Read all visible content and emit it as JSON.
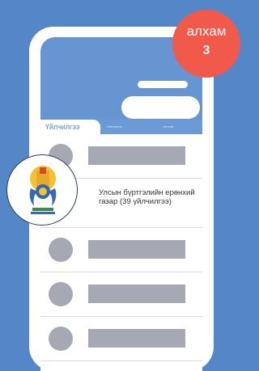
{
  "badge": {
    "label": "алхам",
    "number": "3",
    "color": "#f15a4a"
  },
  "tabs": [
    {
      "label": "Үйлчилгээ",
      "active": true
    },
    {
      "label": "Нэвтэрнэх",
      "active": false
    },
    {
      "label": "Миний",
      "active": false
    }
  ],
  "highlighted_item": {
    "title": "Улсын бүртгэлийн ерөнхий газар (39 үйлчилгээ)",
    "icon": "state-emblem-icon"
  },
  "colors": {
    "background": "#5586c8",
    "screen_header": "#6695d2",
    "placeholder": "#a6a9b3"
  }
}
